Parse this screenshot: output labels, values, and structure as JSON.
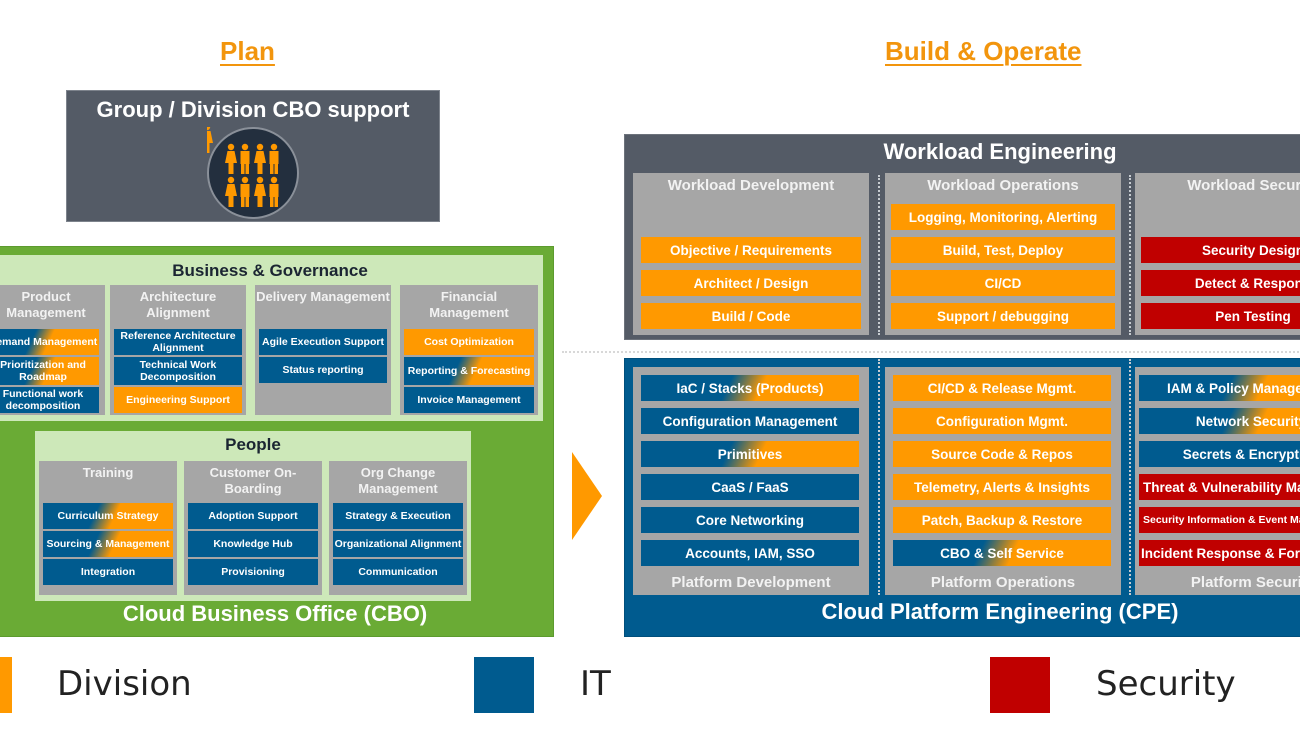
{
  "colors": {
    "division": "#ff9900",
    "it": "#005b8f",
    "security": "#c00000",
    "cbo_green": "#6aab35",
    "panel_green": "#cde8b9",
    "dark_slate": "#545b66",
    "gray": "#a6a6a6"
  },
  "phases": {
    "plan": "Plan",
    "build_operate": "Build & Operate"
  },
  "group_support": {
    "title": "Group / Division CBO support",
    "icon": "people-group-icon"
  },
  "cbo": {
    "title": "Cloud Business Office (CBO)",
    "business_governance": {
      "title": "Business & Governance",
      "columns": [
        {
          "title": "Product Management",
          "items": [
            {
              "label": "Demand Management",
              "type": "mixed"
            },
            {
              "label": "Prioritization and Roadmap",
              "type": "mixed"
            },
            {
              "label": "Functional work decomposition",
              "type": "it"
            }
          ]
        },
        {
          "title": "Architecture Alignment",
          "items": [
            {
              "label": "Reference Architecture Alignment",
              "type": "it"
            },
            {
              "label": "Technical Work Decomposition",
              "type": "it"
            },
            {
              "label": "Engineering Support",
              "type": "division"
            }
          ]
        },
        {
          "title": "Delivery Management",
          "items": [
            {
              "label": "Agile Execution Support",
              "type": "it"
            },
            {
              "label": "Status reporting",
              "type": "it"
            }
          ]
        },
        {
          "title": "Financial Management",
          "items": [
            {
              "label": "Cost Optimization",
              "type": "division"
            },
            {
              "label": "Reporting & Forecasting",
              "type": "mixed"
            },
            {
              "label": "Invoice Management",
              "type": "it"
            }
          ]
        }
      ]
    },
    "people": {
      "title": "People",
      "columns": [
        {
          "title": "Training",
          "items": [
            {
              "label": "Curriculum Strategy",
              "type": "mixed"
            },
            {
              "label": "Sourcing & Management",
              "type": "mixed"
            },
            {
              "label": "Integration",
              "type": "it"
            }
          ]
        },
        {
          "title": "Customer On-Boarding",
          "items": [
            {
              "label": "Adoption Support",
              "type": "it"
            },
            {
              "label": "Knowledge Hub",
              "type": "it"
            },
            {
              "label": "Provisioning",
              "type": "it"
            }
          ]
        },
        {
          "title": "Org Change Management",
          "items": [
            {
              "label": "Strategy & Execution",
              "type": "it"
            },
            {
              "label": "Organizational Alignment",
              "type": "it"
            },
            {
              "label": "Communication",
              "type": "it"
            }
          ]
        }
      ]
    }
  },
  "workload_engineering": {
    "title": "Workload Engineering",
    "columns": [
      {
        "title": "Workload Development",
        "items": [
          {
            "label": "Objective / Requirements",
            "type": "division"
          },
          {
            "label": "Architect / Design",
            "type": "division"
          },
          {
            "label": "Build / Code",
            "type": "division"
          }
        ]
      },
      {
        "title": "Workload Operations",
        "items": [
          {
            "label": "Logging, Monitoring, Alerting",
            "type": "division"
          },
          {
            "label": "Build, Test, Deploy",
            "type": "division"
          },
          {
            "label": "CI/CD",
            "type": "division"
          },
          {
            "label": "Support / debugging",
            "type": "division"
          }
        ]
      },
      {
        "title": "Workload Security",
        "items": [
          {
            "label": "Security Design",
            "type": "security"
          },
          {
            "label": "Detect & Respond",
            "type": "security"
          },
          {
            "label": "Pen Testing",
            "type": "security"
          }
        ]
      }
    ]
  },
  "cpe": {
    "title": "Cloud Platform Engineering (CPE)",
    "columns": [
      {
        "title": "Platform Development",
        "items": [
          {
            "label": "IaC / Stacks (Products)",
            "type": "mixed"
          },
          {
            "label": "Configuration Management",
            "type": "it"
          },
          {
            "label": "Primitives",
            "type": "mixed"
          },
          {
            "label": "CaaS / FaaS",
            "type": "it"
          },
          {
            "label": "Core Networking",
            "type": "it"
          },
          {
            "label": "Accounts, IAM, SSO",
            "type": "it"
          }
        ]
      },
      {
        "title": "Platform Operations",
        "items": [
          {
            "label": "CI/CD & Release Mgmt.",
            "type": "division"
          },
          {
            "label": "Configuration Mgmt.",
            "type": "division"
          },
          {
            "label": "Source Code & Repos",
            "type": "division"
          },
          {
            "label": "Telemetry, Alerts & Insights",
            "type": "division"
          },
          {
            "label": "Patch, Backup & Restore",
            "type": "division"
          },
          {
            "label": "CBO & Self Service",
            "type": "mixed"
          }
        ]
      },
      {
        "title": "Platform Security",
        "items": [
          {
            "label": "IAM & Policy Management",
            "type": "mixed"
          },
          {
            "label": "Network Security",
            "type": "mixed"
          },
          {
            "label": "Secrets & Encryption",
            "type": "it"
          },
          {
            "label": "Threat & Vulnerability Management",
            "type": "security"
          },
          {
            "label": "Security Information & Event Management",
            "type": "security"
          },
          {
            "label": "Incident Response & Forensics",
            "type": "security"
          }
        ]
      }
    ]
  },
  "legend": [
    {
      "label": "Division",
      "color": "#ff9900"
    },
    {
      "label": "IT",
      "color": "#005b8f"
    },
    {
      "label": "Security",
      "color": "#c00000"
    }
  ]
}
